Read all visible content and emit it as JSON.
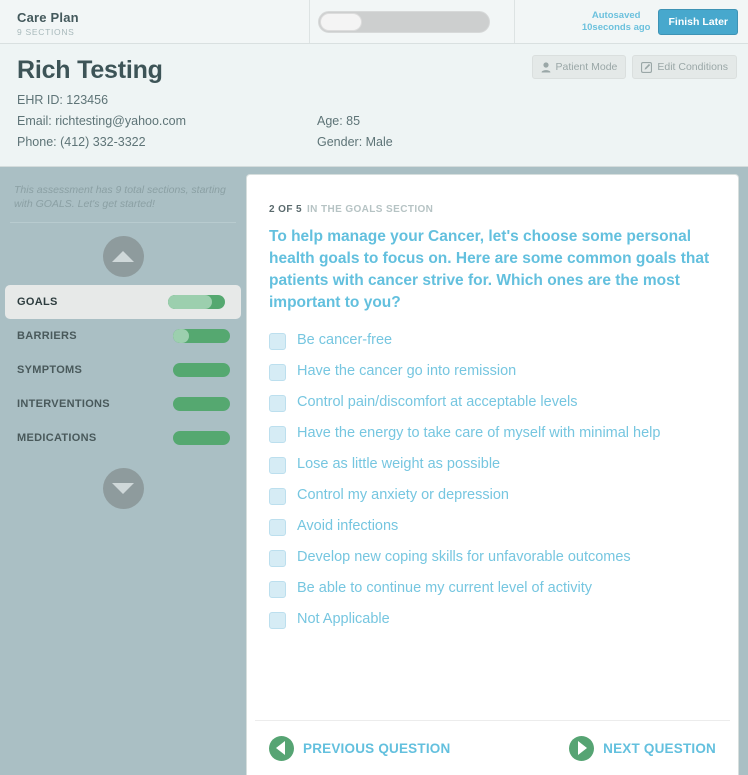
{
  "topbar": {
    "app_title": "Care Plan",
    "sections_label": "9 SECTIONS",
    "toggle_icon": "toggle-switch-off",
    "autosave_line1": "Autosaved",
    "autosave_line2": "10seconds ago",
    "finish_later_label": "Finish Later"
  },
  "patient": {
    "name": "Rich Testing",
    "ehr": "EHR ID: 123456",
    "email": "Email: richtesting@yahoo.com",
    "phone": "Phone: (412) 332-3322",
    "age": "Age: 85",
    "gender": "Gender: Male",
    "patient_mode_label": "Patient Mode",
    "patient_mode_icon": "person-icon",
    "edit_conditions_label": "Edit Conditions",
    "edit_conditions_icon": "pencil-edit-icon"
  },
  "sidebar": {
    "note": "This assessment has 9 total sections, starting with GOALS. Let's get started!",
    "scroll_up_icon": "chevron-up-icon",
    "scroll_down_icon": "chevron-down-icon",
    "sections": [
      {
        "label": "GOALS",
        "progress": 78,
        "active": true
      },
      {
        "label": "BARRIERS",
        "progress": 28,
        "active": false
      },
      {
        "label": "SYMPTOMS",
        "progress": 0,
        "active": false
      },
      {
        "label": "INTERVENTIONS",
        "progress": 0,
        "active": false
      },
      {
        "label": "MEDICATIONS",
        "progress": 0,
        "active": false
      }
    ]
  },
  "question": {
    "counter": "2 OF 5",
    "section_label": "IN THE GOALS SECTION",
    "prompt": "To help manage your Cancer, let's choose some personal health goals to focus on. Here are some common goals that patients with cancer strive for. Which ones are the most important to you?",
    "options": [
      "Be cancer-free",
      "Have the cancer go into remission",
      "Control pain/discomfort at acceptable levels",
      "Have the energy to take care of myself with minimal help",
      "Lose as little weight as possible",
      "Control my anxiety or depression",
      "Avoid infections",
      "Develop new coping skills for unfavorable outcomes",
      "Be able to continue my current level of activity",
      "Not Applicable"
    ]
  },
  "nav": {
    "previous_label": "PREVIOUS QUESTION",
    "previous_icon": "arrow-left-icon",
    "next_label": "NEXT QUESTION",
    "next_icon": "arrow-right-icon"
  },
  "colors": {
    "accent_blue": "#63c0de",
    "green": "#56a473",
    "green_light": "#9ccfae",
    "sidebar_bg": "#aabfc4",
    "finish_btn": "#47a8cd"
  }
}
